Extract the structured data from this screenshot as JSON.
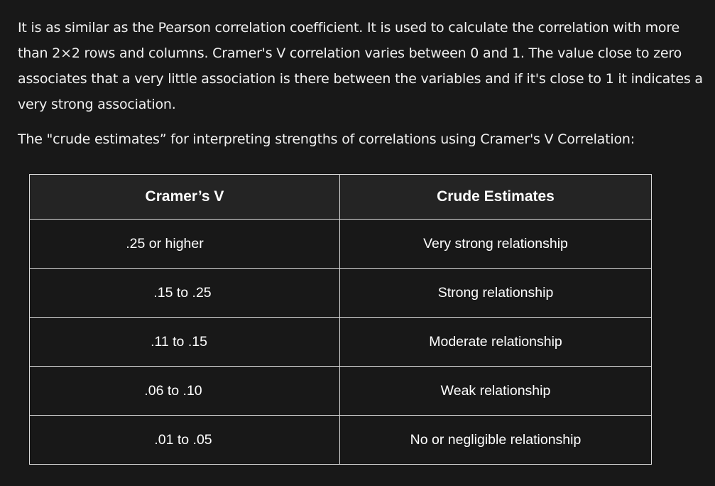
{
  "intro": {
    "paragraph1": "It is as similar as the Pearson correlation coefficient. It is used to calculate the correlation with more than 2×2 rows and columns. Cramer's V correlation varies between 0 and 1. The value close to zero associates that a very little association is there between the variables and if it's close to 1 it indicates a very strong association.",
    "paragraph2": "The \"crude estimates” for interpreting strengths of correlations using Cramer's V Correlation:"
  },
  "table": {
    "headers": [
      "Cramer’s V",
      "Crude Estimates"
    ],
    "rows": [
      [
        ".25 or higher",
        "Very strong relationship"
      ],
      [
        ".15 to .25",
        "Strong relationship"
      ],
      [
        ".11 to .15",
        "Moderate relationship"
      ],
      [
        ".06 to .10",
        "Weak relationship"
      ],
      [
        ".01 to .05",
        "No or negligible relationship"
      ]
    ]
  }
}
